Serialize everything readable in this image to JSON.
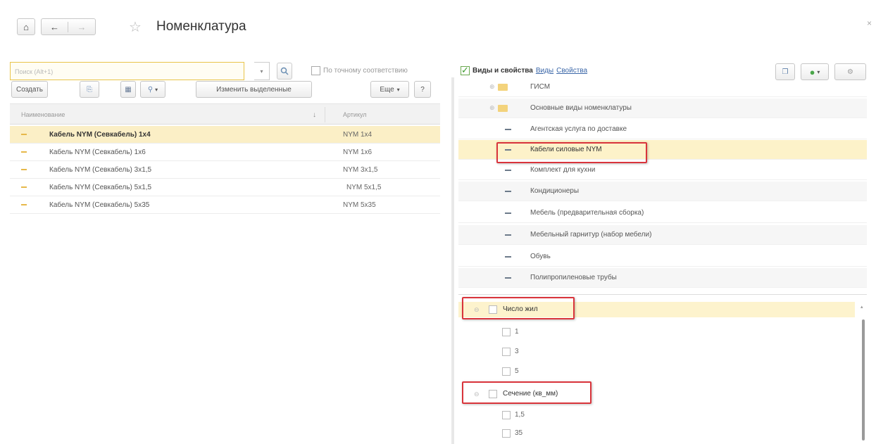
{
  "window": {
    "title": "Номенклатура",
    "close_glyph": "×"
  },
  "search": {
    "placeholder": "Поиск (Alt+1)",
    "exact_match_label": "По точному соответствию",
    "exact_match_checked": false
  },
  "filter_bar": {
    "kinds_props_label": "Виды и свойства",
    "kinds_props_checked": true,
    "link_kinds": "Виды",
    "link_props": "Свойства"
  },
  "toolbar": {
    "create_label": "Создать",
    "edit_selected_label": "Изменить выделенные",
    "more_label": "Еще",
    "help_label": "?"
  },
  "list": {
    "columns": {
      "name": "Наименование",
      "article": "Артикул"
    },
    "rows": [
      {
        "name": "Кабель NYM (Севкабель) 1x4",
        "article": "NYM 1x4"
      },
      {
        "name": "Кабель NYM (Севкабель) 1x6",
        "article": "NYM 1x6"
      },
      {
        "name": "Кабель NYM (Севкабель) 3x1,5",
        "article": "NYM 3x1,5"
      },
      {
        "name": "Кабель NYM (Севкабель) 5x1,5",
        "article": "NYM 5x1,5"
      },
      {
        "name": "Кабель NYM (Севкабель) 5x35",
        "article": "NYM 5x35"
      }
    ]
  },
  "tree": {
    "items": [
      {
        "label": "ГИСМ",
        "type": "folder"
      },
      {
        "label": "Основные виды номенклатуры",
        "type": "folder"
      },
      {
        "label": "Агентская услуга по доставке",
        "type": "item"
      },
      {
        "label": "Кабели силовые NYM",
        "type": "item"
      },
      {
        "label": "Комплект для кухни",
        "type": "item"
      },
      {
        "label": "Кондиционеры",
        "type": "item"
      },
      {
        "label": "Мебель (предварительная сборка)",
        "type": "item"
      },
      {
        "label": "Мебельный гарнитур (набор мебели)",
        "type": "item"
      },
      {
        "label": "Обувь",
        "type": "item"
      },
      {
        "label": "Полипропиленовые трубы",
        "type": "item"
      }
    ]
  },
  "properties": {
    "groups": [
      {
        "label": "Число жил",
        "values": [
          "1",
          "3",
          "5"
        ]
      },
      {
        "label": "Сечение (кв_мм)",
        "values": [
          "1,5",
          "35"
        ]
      }
    ]
  },
  "colors": {
    "accent_selection": "#fbefc6",
    "highlight_border": "#d9343b",
    "link": "#3b67a8",
    "check_green": "#3a9a2a"
  }
}
